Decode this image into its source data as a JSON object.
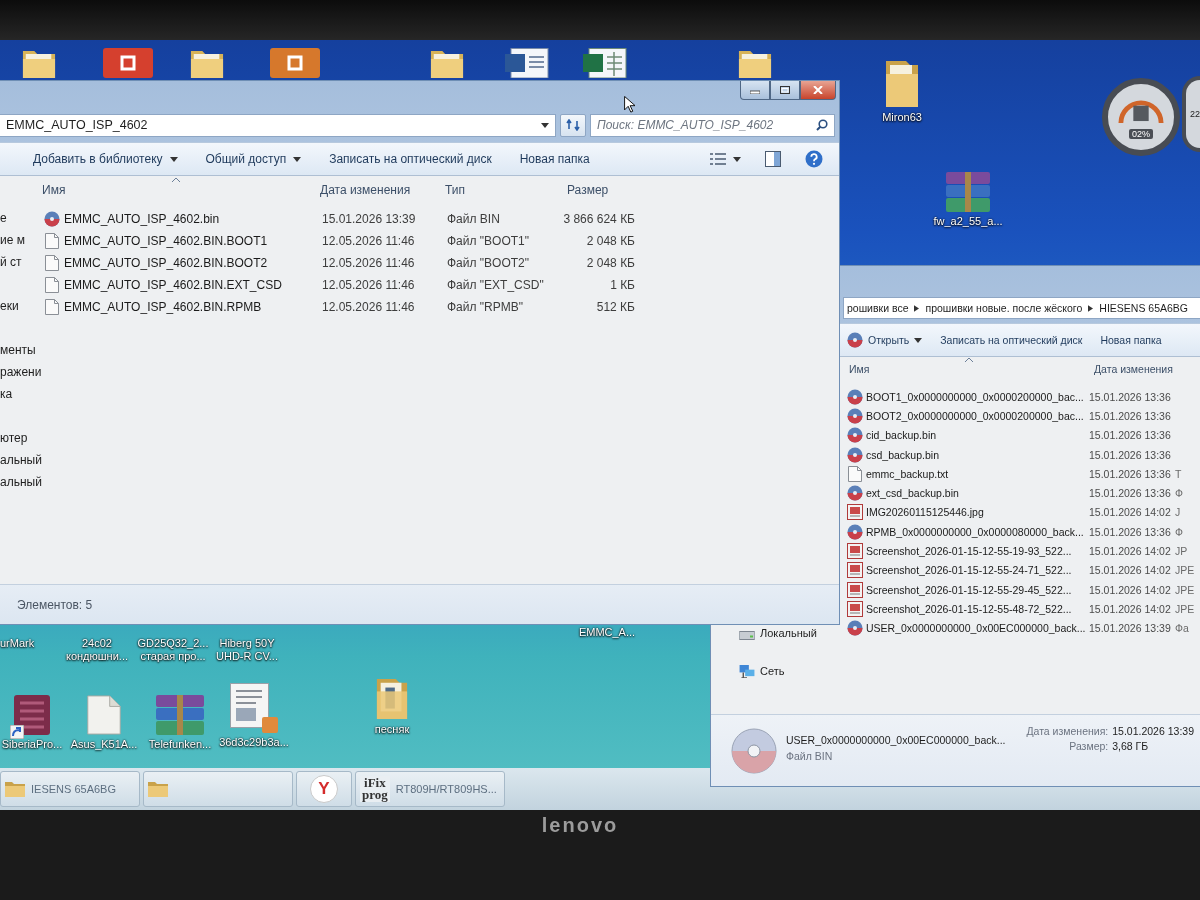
{
  "desktop": {
    "top_icons": [
      {
        "kind": "folder"
      },
      {
        "kind": "app",
        "color": "#d5402e"
      },
      {
        "kind": "folder"
      },
      {
        "kind": "app",
        "color": "#d6782c"
      },
      {
        "kind": "folder"
      },
      {
        "kind": "document"
      },
      {
        "kind": "spreadsheet"
      },
      {
        "kind": "folder"
      }
    ],
    "icons": [
      {
        "kind": "folder",
        "label": "Miron63"
      },
      {
        "kind": "archive",
        "label": "fw_a2_55_a..."
      }
    ],
    "gadgets": [
      {
        "reading": "02%"
      },
      {
        "reading": "22"
      }
    ],
    "covered_labels": [
      {
        "lines": [
          "urMark"
        ]
      },
      {
        "lines": [
          "24c02",
          "кондюшни..."
        ]
      },
      {
        "lines": [
          "GD25Q32_2...",
          "старая про..."
        ]
      },
      {
        "lines": [
          "Hiberg 50Y",
          "UHD-R CV..."
        ]
      },
      {
        "lines": [
          "EMMC_A..."
        ]
      }
    ],
    "bottom_icons": [
      {
        "kind": "app",
        "label": "SiberiaPro...",
        "shortcut": true
      },
      {
        "kind": "file",
        "label": "Asus_K51A...",
        "shortcut": false
      },
      {
        "kind": "archive",
        "label": "Telefunken...",
        "shortcut": false
      },
      {
        "kind": "image",
        "label": "36d3c29b3a...",
        "shortcut": false
      },
      {
        "kind": "folder",
        "label": "песняк",
        "shortcut": false
      }
    ]
  },
  "main_window": {
    "address": "EMMC_AUTO_ISP_4602",
    "search": {
      "placeholder": "Поиск: EMMC_AUTO_ISP_4602"
    },
    "toolbar": [
      {
        "kind": "menu",
        "label": "Добавить в библиотеку"
      },
      {
        "kind": "menu",
        "label": "Общий доступ"
      },
      {
        "kind": "plain",
        "label": "Записать на оптический диск"
      },
      {
        "kind": "plain",
        "label": "Новая папка"
      }
    ],
    "nav_groups": [
      [
        "е",
        "ие м",
        "й ст"
      ],
      [
        "еки"
      ],
      [
        "менты",
        "ражени",
        "ка"
      ],
      [
        "ютер",
        "альный",
        "альный"
      ]
    ],
    "columns": [
      "Имя",
      "Дата изменения",
      "Тип",
      "Размер"
    ],
    "files": [
      {
        "kind": "bin",
        "name": "EMMC_AUTO_ISP_4602.bin",
        "date": "15.01.2026 13:39",
        "type": "Файл BIN",
        "size": "3 866 624 КБ"
      },
      {
        "kind": "file",
        "name": "EMMC_AUTO_ISP_4602.BIN.BOOT1",
        "date": "12.05.2026 11:46",
        "type": "Файл \"BOOT1\"",
        "size": "2 048 КБ"
      },
      {
        "kind": "file",
        "name": "EMMC_AUTO_ISP_4602.BIN.BOOT2",
        "date": "12.05.2026 11:46",
        "type": "Файл \"BOOT2\"",
        "size": "2 048 КБ"
      },
      {
        "kind": "file",
        "name": "EMMC_AUTO_ISP_4602.BIN.EXT_CSD",
        "date": "12.05.2026 11:46",
        "type": "Файл \"EXT_CSD\"",
        "size": "1 КБ"
      },
      {
        "kind": "file",
        "name": "EMMC_AUTO_ISP_4602.BIN.RPMB",
        "date": "12.05.2026 11:46",
        "type": "Файл \"RPMB\"",
        "size": "512 КБ"
      }
    ],
    "status": "Элементов: 5"
  },
  "back_window": {
    "breadcrumb": [
      "рошивки все",
      "прошивки новые. после жёского",
      "HIESENS 65A6BG"
    ],
    "toolbar": [
      {
        "kind": "open",
        "label": "Открыть"
      },
      {
        "kind": "plain",
        "label": "Записать на оптический диск"
      },
      {
        "kind": "plain",
        "label": "Новая папка"
      }
    ],
    "columns": [
      "Имя",
      "Дата изменения"
    ],
    "files": [
      {
        "kind": "bin",
        "name": "BOOT1_0x0000000000_0x0000200000_bac...",
        "date": "15.01.2026 13:36"
      },
      {
        "kind": "bin",
        "name": "BOOT2_0x0000000000_0x0000200000_bac...",
        "date": "15.01.2026 13:36"
      },
      {
        "kind": "bin",
        "name": "cid_backup.bin",
        "date": "15.01.2026 13:36"
      },
      {
        "kind": "bin",
        "name": "csd_backup.bin",
        "date": "15.01.2026 13:36"
      },
      {
        "kind": "file",
        "name": "emmc_backup.txt",
        "date": "15.01.2026 13:36",
        "column_3": "Т"
      },
      {
        "kind": "bin",
        "name": "ext_csd_backup.bin",
        "date": "15.01.2026 13:36",
        "column_3": "Ф"
      },
      {
        "kind": "image",
        "name": "IMG20260115125446.jpg",
        "date": "15.01.2026 14:02",
        "column_3": "J"
      },
      {
        "kind": "bin",
        "name": "RPMB_0x0000000000_0x0000080000_back...",
        "date": "15.01.2026 13:36",
        "column_3": "Ф"
      },
      {
        "kind": "image",
        "name": "Screenshot_2026-01-15-12-55-19-93_522...",
        "date": "15.01.2026 14:02",
        "column_3": "JP"
      },
      {
        "kind": "image",
        "name": "Screenshot_2026-01-15-12-55-24-71_522...",
        "date": "15.01.2026 14:02",
        "column_3": "JPE"
      },
      {
        "kind": "image",
        "name": "Screenshot_2026-01-15-12-55-29-45_522...",
        "date": "15.01.2026 14:02",
        "column_3": "JPE"
      },
      {
        "kind": "image",
        "name": "Screenshot_2026-01-15-12-55-48-72_522...",
        "date": "15.01.2026 14:02",
        "column_3": "JPE"
      },
      {
        "kind": "bin",
        "name": "USER_0x0000000000_0x00EC000000_back...",
        "date": "15.01.2026 13:39",
        "column_3": "Фа"
      }
    ],
    "nav": [
      {
        "kind": "drive",
        "label": "Локальный"
      },
      {
        "kind": "network",
        "label": "Сеть"
      }
    ],
    "details": {
      "name": "USER_0x0000000000_0x00EC000000_back...",
      "type": "Файл BIN",
      "date_label": "Дата изменения:",
      "date": "15.01.2026 13:39",
      "size_label": "Размер:",
      "size": "3,68 ГБ"
    }
  },
  "taskbar": {
    "items": [
      {
        "kind": "folder",
        "label": "IESENS 65A6BG"
      },
      {
        "kind": "folder"
      },
      {
        "kind": "browser",
        "logo": [
          "Y"
        ]
      },
      {
        "kind": "app",
        "logo": [
          "iFix",
          "prog"
        ],
        "label": "RT809H/RT809HS..."
      }
    ]
  },
  "bezel": {
    "logo": "lenovo"
  }
}
